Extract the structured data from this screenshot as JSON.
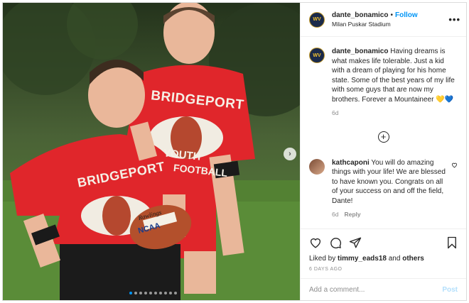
{
  "post": {
    "username": "dante_bonamico",
    "separator": "•",
    "follow_label": "Follow",
    "location": "Milan Puskar Stadium",
    "more_label": "•••",
    "avatar_text": "WV",
    "photo_alt_shirt_text": "BRIDGEPORT",
    "photo_shirt_sub_left": "YOUTH",
    "photo_shirt_sub_right": "FOOTBALL",
    "photo_ball_brand": "Rawlings",
    "photo_ball_text": "NCAA",
    "next_icon": "chevron-right-icon",
    "carousel": {
      "dot_count": 10,
      "active_index": 0
    }
  },
  "caption": {
    "username": "dante_bonamico",
    "text": " Having dreams is what makes life tolerable. Just a kid with a dream of playing for his home state. Some of the best years of my life with some guys that are now my brothers. Forever a Mountaineer 💛💙",
    "time": "6d"
  },
  "load_more_label": "+",
  "comments": [
    {
      "username": "kathcaponi",
      "text": " You will do amazing things with your life! We are blessed to have known you. Congrats on all of your success on and off the field, Dante!",
      "time": "6d",
      "reply_label": "Reply",
      "like_icon": "heart-outline-icon"
    }
  ],
  "actions": {
    "icons": [
      "heart-icon",
      "comment-icon",
      "share-icon",
      "bookmark-icon"
    ],
    "liked_prefix": "Liked by ",
    "liked_user": "timmy_eads18",
    "liked_mid": " and ",
    "liked_others": "others",
    "ago": "6 DAYS AGO"
  },
  "add_comment": {
    "placeholder": "Add a comment...",
    "post_label": "Post"
  },
  "colors": {
    "accent": "#0095f6",
    "post_disabled": "#b2dffc",
    "shirt_red": "#e0262b",
    "grass": "#4c7a34"
  }
}
